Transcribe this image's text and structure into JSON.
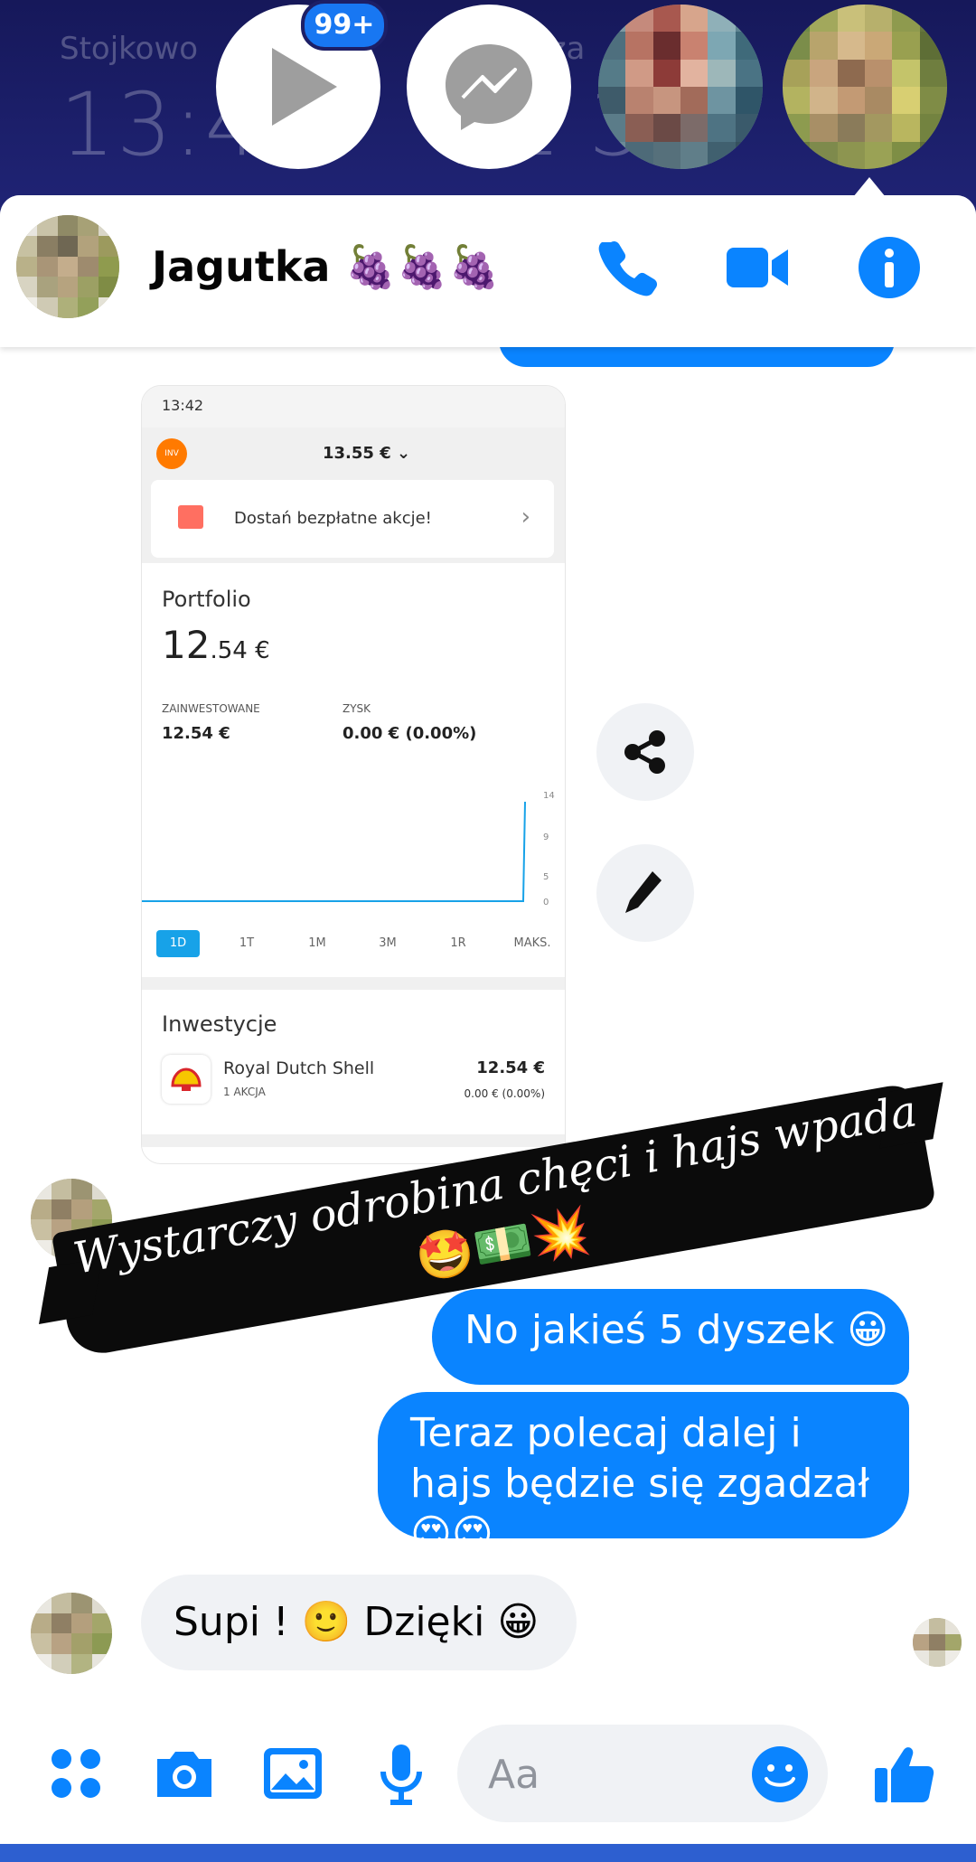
{
  "lockscreen": {
    "location_left": "Stojkowo",
    "time_left": "13:4",
    "location_right": "cza",
    "time_right": "1 3"
  },
  "chat_heads": {
    "badge": "99+"
  },
  "conversation": {
    "contact_name": "Jagutka 🍇🍇🍇"
  },
  "shared_screenshot": {
    "status_time": "13:42",
    "balance": "13.55 € ⌄",
    "invest_logo": "INV",
    "promo_text": "Dostań bezpłatne akcje!",
    "portfolio_label": "Portfolio",
    "portfolio_value_main": "12",
    "portfolio_value_rest": ".54 €",
    "invested_label": "ZAINWESTOWANE",
    "invested_value": "12.54 €",
    "profit_label": "ZYSK",
    "profit_value": "0.00 € (0.00%)",
    "chart_ticks": [
      "14",
      "9",
      "5",
      "0"
    ],
    "ranges": [
      "1D",
      "1T",
      "1M",
      "3M",
      "1R",
      "MAKS."
    ],
    "active_range": "1D",
    "investments_label": "Inwestycje",
    "holding_name": "Royal Dutch Shell",
    "holding_qty": "1 AKCJA",
    "holding_value": "12.54 €",
    "holding_change": "0.00 € (0.00%)"
  },
  "caption": {
    "line1": "Wystarczy odrobina chęci i hajs wpada",
    "line2": "🤩💵💥"
  },
  "messages": [
    {
      "direction": "out",
      "text": "No jakieś 5 dyszek 😀"
    },
    {
      "direction": "out",
      "text": "Teraz polecaj dalej i hajs będzie się zgadzał 😍😍"
    },
    {
      "direction": "in",
      "text": "Supi  !  🙂 Dzięki 😀"
    }
  ],
  "composer": {
    "placeholder": "Aa"
  },
  "colors": {
    "accent": "#0a84ff",
    "bubble_in": "#f0f2f5",
    "icon_blue": "#1877f2"
  }
}
